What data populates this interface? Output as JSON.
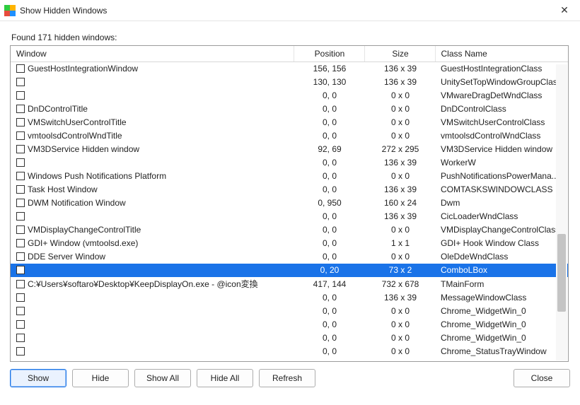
{
  "titlebar": {
    "title": "Show Hidden Windows"
  },
  "found_label": "Found 171 hidden windows:",
  "columns": {
    "window": "Window",
    "position": "Position",
    "size": "Size",
    "class": "Class Name"
  },
  "rows": [
    {
      "window": "GuestHostIntegrationWindow",
      "position": "156, 156",
      "size": "136 x 39",
      "class": "GuestHostIntegrationClass",
      "selected": false
    },
    {
      "window": "",
      "position": "130, 130",
      "size": "136 x 39",
      "class": "UnitySetTopWindowGroupClass",
      "selected": false
    },
    {
      "window": "",
      "position": "0, 0",
      "size": "0 x 0",
      "class": "VMwareDragDetWndClass",
      "selected": false
    },
    {
      "window": "DnDControlTitle",
      "position": "0, 0",
      "size": "0 x 0",
      "class": "DnDControlClass",
      "selected": false
    },
    {
      "window": "VMSwitchUserControlTitle",
      "position": "0, 0",
      "size": "0 x 0",
      "class": "VMSwitchUserControlClass",
      "selected": false
    },
    {
      "window": "vmtoolsdControlWndTitle",
      "position": "0, 0",
      "size": "0 x 0",
      "class": "vmtoolsdControlWndClass",
      "selected": false
    },
    {
      "window": "VM3DService Hidden window",
      "position": "92, 69",
      "size": "272 x 295",
      "class": "VM3DService Hidden window",
      "selected": false
    },
    {
      "window": "",
      "position": "0, 0",
      "size": "136 x 39",
      "class": "WorkerW",
      "selected": false
    },
    {
      "window": "Windows Push Notifications Platform",
      "position": "0, 0",
      "size": "0 x 0",
      "class": "PushNotificationsPowerMana...",
      "selected": false
    },
    {
      "window": "Task Host Window",
      "position": "0, 0",
      "size": "136 x 39",
      "class": "COMTASKSWINDOWCLASS",
      "selected": false
    },
    {
      "window": "DWM Notification Window",
      "position": "0, 950",
      "size": "160 x 24",
      "class": "Dwm",
      "selected": false
    },
    {
      "window": "",
      "position": "0, 0",
      "size": "136 x 39",
      "class": "CicLoaderWndClass",
      "selected": false
    },
    {
      "window": "VMDisplayChangeControlTitle",
      "position": "0, 0",
      "size": "0 x 0",
      "class": "VMDisplayChangeControlClass",
      "selected": false
    },
    {
      "window": "GDI+ Window (vmtoolsd.exe)",
      "position": "0, 0",
      "size": "1 x 1",
      "class": "GDI+ Hook Window Class",
      "selected": false
    },
    {
      "window": "DDE Server Window",
      "position": "0, 0",
      "size": "0 x 0",
      "class": "OleDdeWndClass",
      "selected": false
    },
    {
      "window": "",
      "position": "0, 20",
      "size": "73 x 2",
      "class": "ComboLBox",
      "selected": true
    },
    {
      "window": "C:¥Users¥softaro¥Desktop¥KeepDisplayOn.exe - @icon変換",
      "position": "417, 144",
      "size": "732 x 678",
      "class": "TMainForm",
      "selected": false
    },
    {
      "window": "",
      "position": "0, 0",
      "size": "136 x 39",
      "class": "MessageWindowClass",
      "selected": false
    },
    {
      "window": "",
      "position": "0, 0",
      "size": "0 x 0",
      "class": "Chrome_WidgetWin_0",
      "selected": false
    },
    {
      "window": "",
      "position": "0, 0",
      "size": "0 x 0",
      "class": "Chrome_WidgetWin_0",
      "selected": false
    },
    {
      "window": "",
      "position": "0, 0",
      "size": "0 x 0",
      "class": "Chrome_WidgetWin_0",
      "selected": false
    },
    {
      "window": "",
      "position": "0, 0",
      "size": "0 x 0",
      "class": "Chrome_StatusTrayWindow",
      "selected": false
    }
  ],
  "buttons": {
    "show": "Show",
    "hide": "Hide",
    "show_all": "Show All",
    "hide_all": "Hide All",
    "refresh": "Refresh",
    "close": "Close"
  }
}
